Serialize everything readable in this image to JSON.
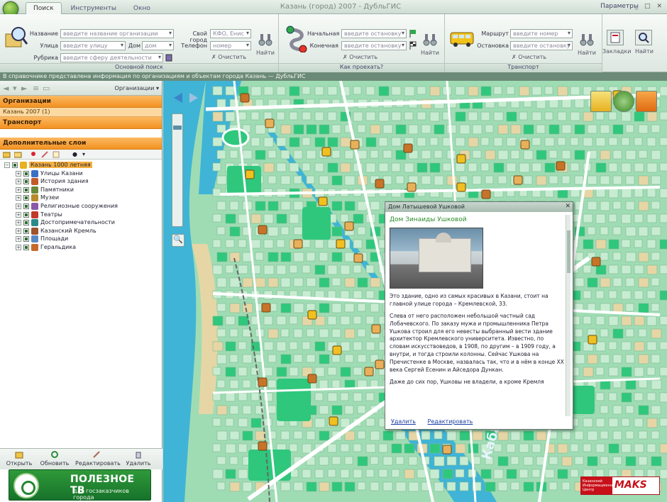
{
  "window": {
    "title": "Казань (город) 2007 - ДубльГИС",
    "tabs": [
      "Поиск",
      "Инструменты",
      "Окно"
    ],
    "params_label": "Параметры",
    "controls": "_ □ ✕"
  },
  "ribbon": {
    "search_group": {
      "title": "Основной поиск",
      "fields": [
        {
          "label": "Название",
          "placeholder": "введите название организации"
        },
        {
          "label": "Улица",
          "placeholder": "введите улицу"
        },
        {
          "label": "Рубрика",
          "placeholder": "введите сферу деятельности"
        }
      ],
      "house_label": "Дом",
      "house_placeholder": "дом",
      "extra_fields": [
        {
          "label": "Свой город",
          "value": "КФО, Енис"
        },
        {
          "label": "Телефон",
          "value": "номер"
        }
      ],
      "clear_label": "Очистить",
      "find_label": "Найти"
    },
    "route_group": {
      "title": "Как проехать?",
      "from_label": "Начальная",
      "to_label": "Конечная",
      "from_placeholder": "введите остановку",
      "to_placeholder": "введите остановку",
      "clear_label": "Очистить",
      "find_label": "Найти"
    },
    "transit_group": {
      "title": "Транспорт",
      "route_label": "Маршрут",
      "stop_label": "Остановка",
      "route_placeholder": "введите номер",
      "stop_placeholder": "введите остановку",
      "clear_label": "Очистить",
      "find_label": "Найти"
    },
    "actions": [
      {
        "label": "Закладки"
      },
      {
        "label": "Найти"
      }
    ]
  },
  "infobar": "В справочнике представлена информация по организациям и объектам города Казань — ДубльГИС",
  "left_panel": {
    "mode": "Организации",
    "sections": [
      "Организации",
      "Транспорт",
      "Дополнительные слои"
    ],
    "org_subitem": "Казань 2007 (1)",
    "tree": [
      {
        "label": "Казань 1000 летняя",
        "selected": true,
        "color": "#e8b020"
      },
      {
        "label": "Улицы Казани",
        "color": "#3a6fc6"
      },
      {
        "label": "История здания",
        "color": "#c45a2a"
      },
      {
        "label": "Памятники",
        "color": "#6a8a3a"
      },
      {
        "label": "Музеи",
        "color": "#b88a2a"
      },
      {
        "label": "Религиозные сооружения",
        "color": "#8a5aa8"
      },
      {
        "label": "Театры",
        "color": "#c0392b"
      },
      {
        "label": "Достопримечательности",
        "color": "#2a8a8a"
      },
      {
        "label": "Казанский Кремль",
        "color": "#a0522d"
      },
      {
        "label": "Площади",
        "color": "#5a8ac6"
      },
      {
        "label": "Геральдика",
        "color": "#c66a2a"
      }
    ],
    "bottom_buttons": [
      "Открыть",
      "Обновить",
      "Редактировать",
      "Удалить"
    ]
  },
  "banner": {
    "title": "ПОЛЕЗНОЕ ТВ",
    "subtitle": "для госзаказчиков города"
  },
  "popup": {
    "window_title": "Дом Латышевой Ушковой",
    "heading": "Дом Зинаиды Ушковой",
    "text1": "Это здание, одно из самых красивых в Казани, стоит на главной улице города – Кремлевской, 33.",
    "text2": "Слева от него расположен небольшой частный сад Лобачевского. По заказу мужа и промышленника Петра Ушкова строил для его невесты выбранный вести здание архитектор Кремлевского университета. Известно, по словам искусствоведов, в 1908, по другим – в 1909 году, а внутри, и тогда строили колонны. Сейчас Ушкова на Пречистенке в Москве, назвалась так, что и в нём в конце XX века Сергей Есенин и Айседора Дункан.",
    "text3": "Даже до сих пор, Ушковы не владели, а кроме Кремля",
    "links": [
      "Удалить",
      "Редактировать"
    ]
  },
  "map": {
    "river_label": "Кабан",
    "colors": {
      "water": "#3fb4d6",
      "block": "#c8ecd2",
      "park": "#2fc77c",
      "road": "#ffffff",
      "sand": "#e6d6a6"
    },
    "mode_icons": [
      "measure-icon",
      "globe-icon",
      "layers-icon"
    ]
  },
  "partner_logo": {
    "left_text": "Казанский Информационный Центр",
    "right_text": "MAKS"
  }
}
